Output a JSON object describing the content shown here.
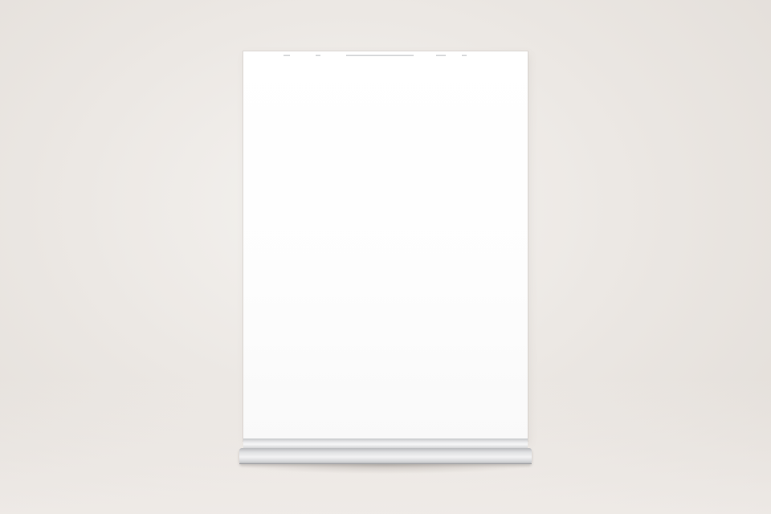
{
  "scene": {
    "subject": "acrylic-sign-holder",
    "background_color": "#ece8e4",
    "sheet_color": "#ffffff",
    "base_color": "#d5d6d8"
  }
}
